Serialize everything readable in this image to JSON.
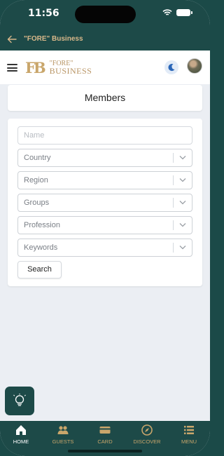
{
  "status_bar": {
    "time": "11:56"
  },
  "nav": {
    "title": "\"FORE\" Business"
  },
  "logo": {
    "mark": "FB",
    "line1": "\"FORE\"",
    "line2": "BUSINESS"
  },
  "page": {
    "title": "Members"
  },
  "form": {
    "name_placeholder": "Name",
    "selects": [
      {
        "label": "Country"
      },
      {
        "label": "Region"
      },
      {
        "label": "Groups"
      },
      {
        "label": "Profession"
      },
      {
        "label": "Keywords"
      }
    ],
    "search_label": "Search"
  },
  "tabs": [
    {
      "label": "HOME",
      "icon": "home-icon",
      "active": true
    },
    {
      "label": "GUESTS",
      "icon": "guests-icon"
    },
    {
      "label": "CARD",
      "icon": "card-icon"
    },
    {
      "label": "DISCOVER",
      "icon": "compass-icon"
    },
    {
      "label": "MENU",
      "icon": "list-icon"
    }
  ],
  "colors": {
    "brand": "#1d4a48",
    "accent": "#c9a66b",
    "background": "#ebeef3"
  }
}
